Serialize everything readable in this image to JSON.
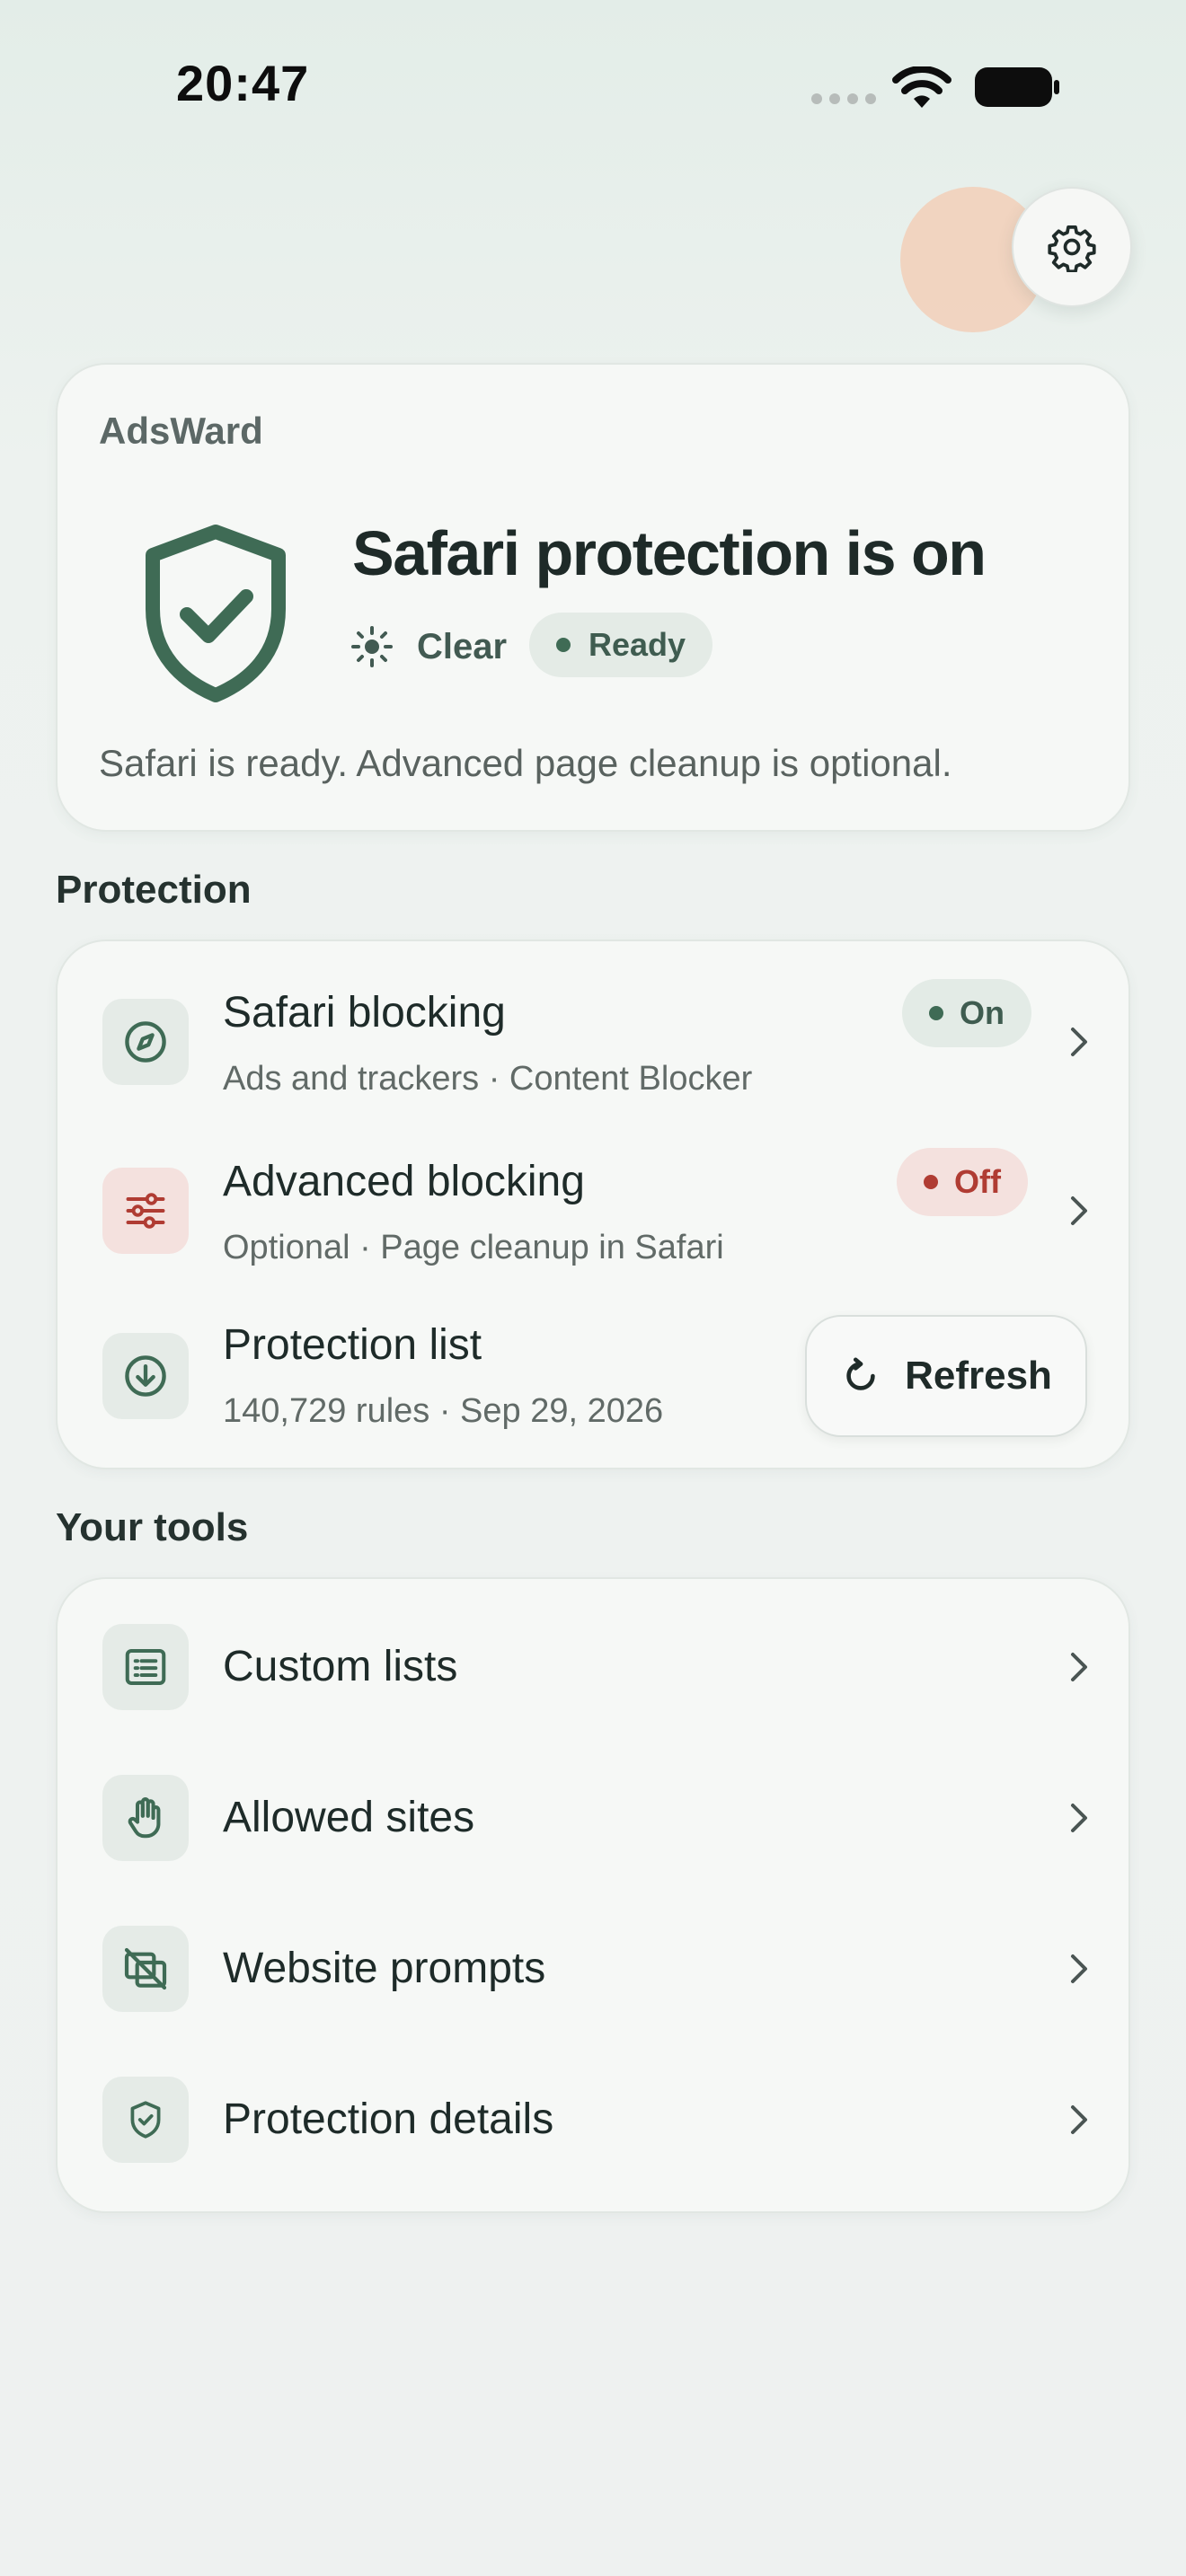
{
  "status_bar": {
    "time": "20:47"
  },
  "header": {
    "settings_icon": "gear-icon"
  },
  "hero": {
    "app_name": "AdsWard",
    "title": "Safari protection is on",
    "weather_label": "Clear",
    "status_label": "Ready",
    "description": "Safari is ready. Advanced page cleanup is optional.",
    "accent_color": "#3f6b55"
  },
  "protection": {
    "section_title": "Protection",
    "items": [
      {
        "title": "Safari blocking",
        "subtitle": "Ads and trackers · Content Blocker",
        "state": "On",
        "icon": "compass-icon",
        "state_color": "#3f6b55"
      },
      {
        "title": "Advanced blocking",
        "subtitle": "Optional · Page cleanup in Safari",
        "state": "Off",
        "icon": "sliders-icon",
        "state_color": "#b03c33"
      },
      {
        "title": "Protection list",
        "subtitle": "140,729 rules · Sep 29, 2026",
        "action_label": "Refresh",
        "icon": "download-circle-icon"
      }
    ]
  },
  "tools": {
    "section_title": "Your tools",
    "items": [
      {
        "title": "Custom lists",
        "icon": "list-icon"
      },
      {
        "title": "Allowed sites",
        "icon": "hand-icon"
      },
      {
        "title": "Website prompts",
        "icon": "prompt-slash-icon"
      },
      {
        "title": "Protection details",
        "icon": "shield-check-icon"
      }
    ]
  }
}
